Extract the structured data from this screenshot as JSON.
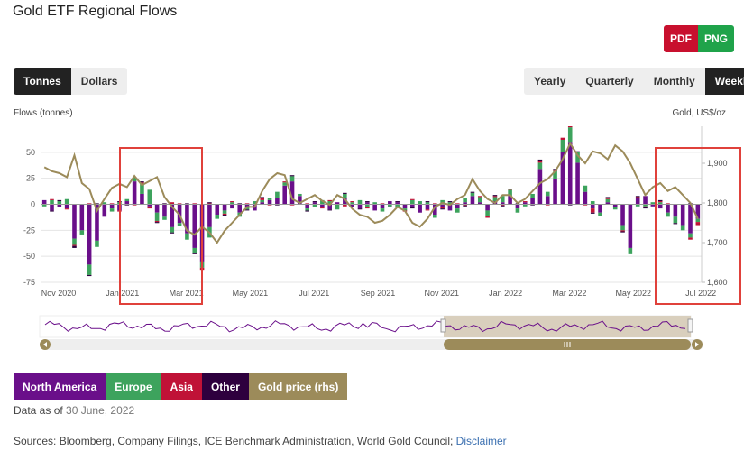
{
  "title": "Gold ETF Regional Flows",
  "export": {
    "pdf": "PDF",
    "png": "PNG"
  },
  "unit_toggle": {
    "options": [
      "Tonnes",
      "Dollars"
    ],
    "selected": "Tonnes"
  },
  "period_toggle": {
    "options": [
      "Yearly",
      "Quarterly",
      "Monthly",
      "Weekly"
    ],
    "selected": "Weekly"
  },
  "legend": [
    {
      "label": "North America",
      "color": "#6a0f8a"
    },
    {
      "label": "Europe",
      "color": "#3da35d"
    },
    {
      "label": "Asia",
      "color": "#c01237"
    },
    {
      "label": "Other",
      "color": "#2e003e"
    },
    {
      "label": "Gold price (rhs)",
      "color": "#9c8b5a"
    }
  ],
  "footer": {
    "as_of_label": "Data as of",
    "as_of_date": "30 June, 2022",
    "sources": "Sources: Bloomberg, Company Filings, ICE Benchmark Administration, World Gold Council;",
    "disclaimer": "Disclaimer"
  },
  "highlight_color": "#e0413b",
  "chart_data": {
    "type": "bar",
    "ylabel": "Flows (tonnes)",
    "y2label": "Gold, US$/oz",
    "ylim": [
      -75,
      75
    ],
    "y2lim": [
      1600,
      1950
    ],
    "y_ticks": [
      50,
      25,
      0,
      -25,
      -50,
      -75
    ],
    "y2_ticks": [
      1900,
      1800,
      1700,
      1600
    ],
    "x_labels": [
      "Nov 2020",
      "Jan 2021",
      "Mar 2021",
      "May 2021",
      "Jul 2021",
      "Sep 2021",
      "Nov 2021",
      "Jan 2022",
      "Mar 2022",
      "May 2022",
      "Jul 2022"
    ],
    "grid": true,
    "stacked": true,
    "weeks": 88,
    "series": [
      {
        "name": "North America",
        "color": "#6a0f8a",
        "values": [
          4,
          -6,
          -3,
          -4,
          -33,
          -25,
          -58,
          -35,
          -12,
          -4,
          -6,
          3,
          22,
          10,
          -2,
          -8,
          -12,
          -22,
          -18,
          -28,
          -42,
          -55,
          -22,
          -10,
          -6,
          -4,
          -8,
          -3,
          -6,
          2,
          4,
          6,
          18,
          22,
          8,
          -4,
          2,
          -3,
          -5,
          2,
          6,
          -3,
          -4,
          2,
          -6,
          -4,
          3,
          2,
          -4,
          -3,
          -8,
          -5,
          -10,
          -3,
          -6,
          -4,
          2,
          8,
          2,
          -6,
          3,
          2,
          8,
          -4,
          2,
          6,
          34,
          8,
          24,
          50,
          60,
          40,
          12,
          -4,
          -8,
          2,
          -3,
          -20,
          -42,
          6,
          8,
          -2,
          -4,
          -8,
          -12,
          -20,
          -28,
          -14
        ]
      },
      {
        "name": "Europe",
        "color": "#3da35d",
        "values": [
          -2,
          4,
          3,
          5,
          -6,
          -4,
          -10,
          -6,
          2,
          -3,
          2,
          2,
          4,
          10,
          14,
          -8,
          -3,
          -5,
          -3,
          -6,
          -5,
          -6,
          -10,
          -4,
          -3,
          2,
          -4,
          -2,
          3,
          2,
          2,
          6,
          3,
          5,
          2,
          -2,
          -3,
          4,
          3,
          -5,
          4,
          2,
          4,
          -3,
          2,
          -3,
          -2,
          -3,
          -2,
          4,
          3,
          2,
          -3,
          4,
          2,
          -4,
          4,
          3,
          5,
          -5,
          4,
          6,
          6,
          -4,
          -2,
          4,
          6,
          4,
          8,
          12,
          14,
          10,
          6,
          3,
          -3,
          3,
          -2,
          -5,
          -6,
          -2,
          -2,
          2,
          2,
          -4,
          -6,
          -5,
          -4,
          -3
        ]
      },
      {
        "name": "Asia",
        "color": "#c01237",
        "values": [
          0,
          1,
          0,
          -1,
          -1,
          0,
          1,
          0,
          0,
          1,
          -1,
          0,
          -1,
          1,
          -2,
          -1,
          0,
          2,
          1,
          0,
          1,
          -2,
          1,
          0,
          -1,
          1,
          0,
          1,
          0,
          2,
          -1,
          0,
          1,
          -1,
          0,
          1,
          0,
          -1,
          1,
          0,
          -2,
          1,
          0,
          -1,
          0,
          1,
          0,
          0,
          -1,
          1,
          0,
          -1,
          1,
          -1,
          0,
          1,
          -1,
          0,
          1,
          -2,
          1,
          -1,
          1,
          0,
          1,
          0,
          2,
          -1,
          1,
          2,
          1,
          0,
          -1,
          -4,
          0,
          1,
          0,
          -1,
          0,
          1,
          -1,
          0,
          1,
          1,
          0,
          0,
          -2,
          -3
        ]
      },
      {
        "name": "Other",
        "color": "#2e003e",
        "values": [
          0,
          -1,
          1,
          0,
          -2,
          0,
          -1,
          1,
          0,
          0,
          1,
          -1,
          0,
          1,
          0,
          -1,
          1,
          -1,
          0,
          1,
          -1,
          0,
          1,
          0,
          -1,
          0,
          1,
          -1,
          0,
          1,
          0,
          -1,
          0,
          1,
          0,
          -1,
          1,
          0,
          -1,
          0,
          1,
          0,
          -1,
          1,
          0,
          0,
          -1,
          1,
          0,
          -1,
          0,
          1,
          0,
          -1,
          1,
          0,
          -1,
          1,
          0,
          0,
          1,
          -1,
          0,
          1,
          0,
          -1,
          1,
          0,
          1,
          0,
          -1,
          1,
          0,
          -1,
          0,
          1,
          0,
          -1,
          0,
          1,
          -1,
          0,
          1,
          0,
          -1,
          0,
          1,
          0
        ]
      },
      {
        "name": "Gold price (rhs)",
        "color": "#9c8b5a",
        "values": [
          1890,
          1880,
          1875,
          1865,
          1920,
          1850,
          1835,
          1780,
          1810,
          1838,
          1848,
          1840,
          1868,
          1845,
          1855,
          1865,
          1815,
          1790,
          1770,
          1730,
          1720,
          1740,
          1725,
          1700,
          1730,
          1750,
          1770,
          1790,
          1790,
          1830,
          1860,
          1875,
          1870,
          1810,
          1800,
          1810,
          1820,
          1805,
          1795,
          1820,
          1810,
          1785,
          1770,
          1765,
          1750,
          1755,
          1770,
          1790,
          1780,
          1750,
          1740,
          1760,
          1790,
          1800,
          1795,
          1810,
          1820,
          1860,
          1830,
          1810,
          1800,
          1820,
          1820,
          1800,
          1810,
          1830,
          1850,
          1860,
          1880,
          1910,
          1950,
          1920,
          1900,
          1930,
          1925,
          1910,
          1945,
          1930,
          1900,
          1860,
          1820,
          1840,
          1850,
          1830,
          1840,
          1820,
          1800,
          1760
        ]
      }
    ],
    "highlight_ranges": [
      [
        "Dec 2020",
        "Mar 2021"
      ],
      [
        "Jun 2022",
        "Jul 2022"
      ]
    ]
  }
}
